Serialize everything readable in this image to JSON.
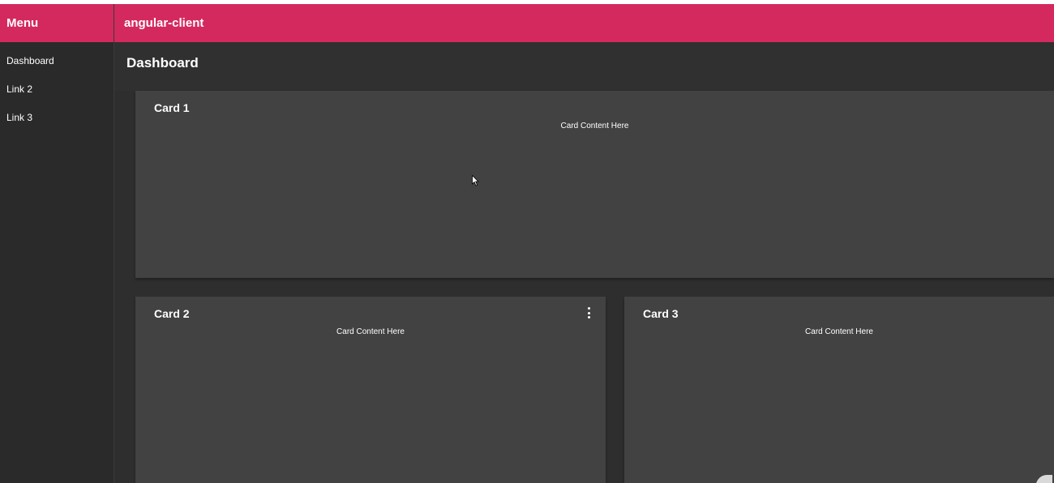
{
  "sidebar": {
    "title": "Menu",
    "items": [
      {
        "label": "Dashboard"
      },
      {
        "label": "Link 2"
      },
      {
        "label": "Link 3"
      }
    ]
  },
  "toolbar": {
    "title": "angular-client"
  },
  "page": {
    "title": "Dashboard"
  },
  "cards": [
    {
      "title": "Card 1",
      "content": "Card Content Here"
    },
    {
      "title": "Card 2",
      "content": "Card Content Here"
    },
    {
      "title": "Card 3",
      "content": "Card Content Here"
    }
  ],
  "icons": {
    "card_menu": "more-vert-icon",
    "cursor": "mouse-cursor-icon"
  },
  "colors": {
    "accent": "#d4295f",
    "background": "#303030",
    "sidebar": "#2a2a2a",
    "card": "#424242"
  }
}
